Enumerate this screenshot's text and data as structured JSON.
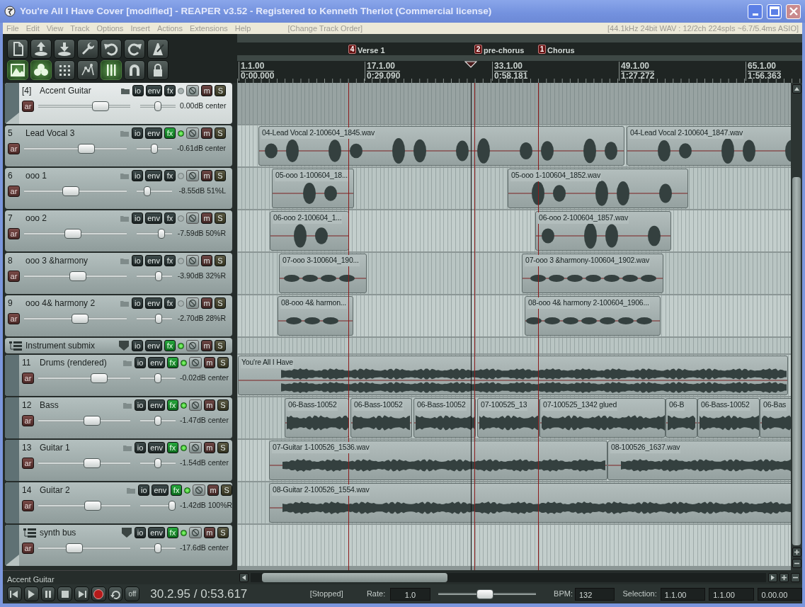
{
  "window": {
    "title": "You're All I Have Cover [modified] - REAPER v3.52 - Registered to Kenneth Theriot (Commercial license)"
  },
  "menu": {
    "items": [
      "File",
      "Edit",
      "View",
      "Track",
      "Options",
      "Insert",
      "Actions",
      "Extensions",
      "Help"
    ],
    "hint": "[Change Track Order]",
    "status": "[44.1kHz 24bit WAV : 12/2ch 224spls ~6.7/5.4ms ASIO]"
  },
  "toolbar": [
    {
      "kind": "new",
      "on": false
    },
    {
      "kind": "open",
      "on": false
    },
    {
      "kind": "save",
      "on": false
    },
    {
      "kind": "settings",
      "on": false
    },
    {
      "kind": "undo",
      "on": false
    },
    {
      "kind": "redo",
      "on": false
    },
    {
      "kind": "metronome",
      "on": false
    },
    {
      "kind": "crossfade",
      "on": true
    },
    {
      "kind": "grouping",
      "on": true
    },
    {
      "kind": "grid",
      "on": false
    },
    {
      "kind": "envelope",
      "on": false
    },
    {
      "kind": "snap",
      "on": true
    },
    {
      "kind": "magnet",
      "on": false
    },
    {
      "kind": "lock",
      "on": false
    }
  ],
  "markers": [
    {
      "number": "4",
      "label": "Verse 1"
    },
    {
      "number": "2",
      "label": "pre-chorus"
    },
    {
      "number": "1",
      "label": "Chorus"
    }
  ],
  "ruler": [
    {
      "bar": "1.1.00",
      "time": "0:00.000"
    },
    {
      "bar": "17.1.00",
      "time": "0:29.090"
    },
    {
      "bar": "33.1.00",
      "time": "0:58.181"
    },
    {
      "bar": "49.1.00",
      "time": "1:27.272"
    },
    {
      "bar": "65.1.00",
      "time": "1:56.363"
    }
  ],
  "tracks": [
    {
      "number": "[4]",
      "name": "Accent Guitar",
      "kind": "track",
      "selected": true,
      "folder_end": true,
      "fx_active": false,
      "buttons": {
        "io": "io",
        "env": "env",
        "fx": "fx",
        "mute": "m",
        "solo": "S",
        "arm": "ar"
      },
      "volume": {
        "level": 0.72
      },
      "pan": {
        "level": 0.5
      },
      "reading": "0.00dB center"
    },
    {
      "number": "5",
      "name": "Lead Vocal 3",
      "kind": "track",
      "selected": false,
      "folder_end": false,
      "fx_active": true,
      "buttons": {
        "io": "io",
        "env": "env",
        "fx": "fx",
        "mute": "m",
        "solo": "S",
        "arm": "ar"
      },
      "volume": {
        "level": 0.63
      },
      "pan": {
        "level": 0.5
      },
      "reading": "-0.61dB center",
      "clips": [
        {
          "label": "04-Lead Vocal 2-100604_1845.wav"
        },
        {
          "label": "04-Lead Vocal 2-100604_1847.wav"
        }
      ]
    },
    {
      "number": "6",
      "name": "ooo 1",
      "kind": "track",
      "selected": false,
      "folder_end": false,
      "fx_active": false,
      "buttons": {
        "io": "io",
        "env": "env",
        "fx": "fx",
        "mute": "m",
        "solo": "S",
        "arm": "ar"
      },
      "volume": {
        "level": 0.45
      },
      "pan": {
        "level": 0.26
      },
      "reading": "-8.55dB 51%L",
      "clips": [
        {
          "label": "05-ooo 1-100604_18..."
        },
        {
          "label": "05-ooo 1-100604_1852.wav"
        }
      ]
    },
    {
      "number": "7",
      "name": "ooo 2",
      "kind": "track",
      "selected": false,
      "folder_end": false,
      "fx_active": false,
      "buttons": {
        "io": "io",
        "env": "env",
        "fx": "fx",
        "mute": "m",
        "solo": "S",
        "arm": "ar"
      },
      "volume": {
        "level": 0.47
      },
      "pan": {
        "level": 0.75
      },
      "reading": "-7.59dB 50%R",
      "clips": [
        {
          "label": "06-ooo 2-100604_1..."
        },
        {
          "label": "06-ooo 2-100604_1857.wav"
        }
      ]
    },
    {
      "number": "8",
      "name": "ooo 3 &harmony",
      "kind": "track",
      "selected": false,
      "folder_end": false,
      "fx_active": false,
      "buttons": {
        "io": "io",
        "env": "env",
        "fx": "fx",
        "mute": "m",
        "solo": "S",
        "arm": "ar"
      },
      "volume": {
        "level": 0.53
      },
      "pan": {
        "level": 0.66
      },
      "reading": "-3.90dB 32%R",
      "clips": [
        {
          "label": "07-ooo 3-100604_190..."
        },
        {
          "label": "07-ooo 3 &harmony-100604_1902.wav"
        }
      ]
    },
    {
      "number": "9",
      "name": "ooo 4& harmony 2",
      "kind": "track",
      "selected": false,
      "folder_end": false,
      "fx_active": false,
      "buttons": {
        "io": "io",
        "env": "env",
        "fx": "fx",
        "mute": "m",
        "solo": "S",
        "arm": "ar"
      },
      "volume": {
        "level": 0.55
      },
      "pan": {
        "level": 0.64
      },
      "reading": "-2.70dB 28%R",
      "clips": [
        {
          "label": "08-ooo 4& harmon..."
        },
        {
          "label": "08-ooo 4& harmony 2-100604_1906..."
        }
      ]
    },
    {
      "name": "Instrument submix",
      "kind": "folder",
      "selected": false,
      "folder_end": false,
      "fx_active": true,
      "buttons": {
        "io": "io",
        "env": "env",
        "fx": "fx",
        "mute": "m",
        "solo": "S"
      },
      "children": [
        {
          "number": "11",
          "name": "Drums (rendered)",
          "kind": "track",
          "selected": false,
          "folder_end": false,
          "fx_active": true,
          "buttons": {
            "io": "io",
            "env": "env",
            "fx": "fx",
            "mute": "m",
            "solo": "S",
            "arm": "ar"
          },
          "volume": {
            "level": 0.7
          },
          "pan": {
            "level": 0.5
          },
          "reading": "-0.02dB center",
          "clips": [
            {
              "label": "You're All I Have"
            }
          ]
        },
        {
          "number": "12",
          "name": "Bass",
          "kind": "track",
          "selected": false,
          "folder_end": false,
          "fx_active": true,
          "buttons": {
            "io": "io",
            "env": "env",
            "fx": "fx",
            "mute": "m",
            "solo": "S",
            "arm": "ar"
          },
          "volume": {
            "level": 0.6
          },
          "pan": {
            "level": 0.5
          },
          "reading": "-1.47dB center",
          "clips": [
            {
              "label": "06-Bass-10052"
            },
            {
              "label": "06-Bass-10052"
            },
            {
              "label": "06-Bass-10052"
            },
            {
              "label": "07-100525_13"
            },
            {
              "label": "07-100525_1342 glued"
            },
            {
              "label": "06-B"
            },
            {
              "label": "06-Bass-10052"
            },
            {
              "label": "06-Bas"
            }
          ]
        },
        {
          "number": "13",
          "name": "Guitar 1",
          "kind": "track",
          "selected": false,
          "folder_end": false,
          "fx_active": true,
          "buttons": {
            "io": "io",
            "env": "env",
            "fx": "fx",
            "mute": "m",
            "solo": "S",
            "arm": "ar"
          },
          "volume": {
            "level": 0.6
          },
          "pan": {
            "level": 0.5
          },
          "reading": "-1.54dB center",
          "clips": [
            {
              "label": "07-Guitar 1-100526_1536.wav"
            },
            {
              "label": "08-100526_1637.wav"
            }
          ]
        },
        {
          "number": "14",
          "name": "Guitar 2",
          "kind": "track",
          "selected": false,
          "folder_end": false,
          "fx_active": true,
          "buttons": {
            "io": "io",
            "env": "env",
            "fx": "fx",
            "mute": "m",
            "solo": "S",
            "arm": "ar"
          },
          "volume": {
            "level": 0.61
          },
          "pan": {
            "level": 1.0
          },
          "reading": "-1.42dB 100%R",
          "clips": [
            {
              "label": "08-Guitar 2-100526_1554.wav"
            }
          ]
        },
        {
          "name": "synth bus",
          "kind": "folder",
          "selected": false,
          "folder_end": true,
          "fx_active": true,
          "buttons": {
            "io": "io",
            "env": "env",
            "fx": "fx",
            "mute": "m",
            "solo": "S",
            "arm": "ar"
          },
          "volume": {
            "level": 0.37
          },
          "pan": {
            "level": 0.5
          },
          "reading": "-17.6dB center"
        }
      ]
    }
  ],
  "status": "Accent Guitar",
  "transport": {
    "buttons": [
      {
        "kind": "start"
      },
      {
        "kind": "play"
      },
      {
        "kind": "pause"
      },
      {
        "kind": "stop"
      },
      {
        "kind": "end"
      },
      {
        "kind": "record"
      },
      {
        "kind": "repeat"
      },
      {
        "kind": "text",
        "label": "off"
      }
    ],
    "position": "30.2.95 / 0:53.617",
    "state": "[Stopped]",
    "rate_label": "Rate:",
    "rate": "1.0",
    "rate_slider": {
      "level": 0.47
    },
    "bpm_label": "BPM:",
    "bpm": "132",
    "selection_label": "Selection:",
    "selection": [
      "1.1.00",
      "1.1.00",
      "0.00.00"
    ]
  }
}
